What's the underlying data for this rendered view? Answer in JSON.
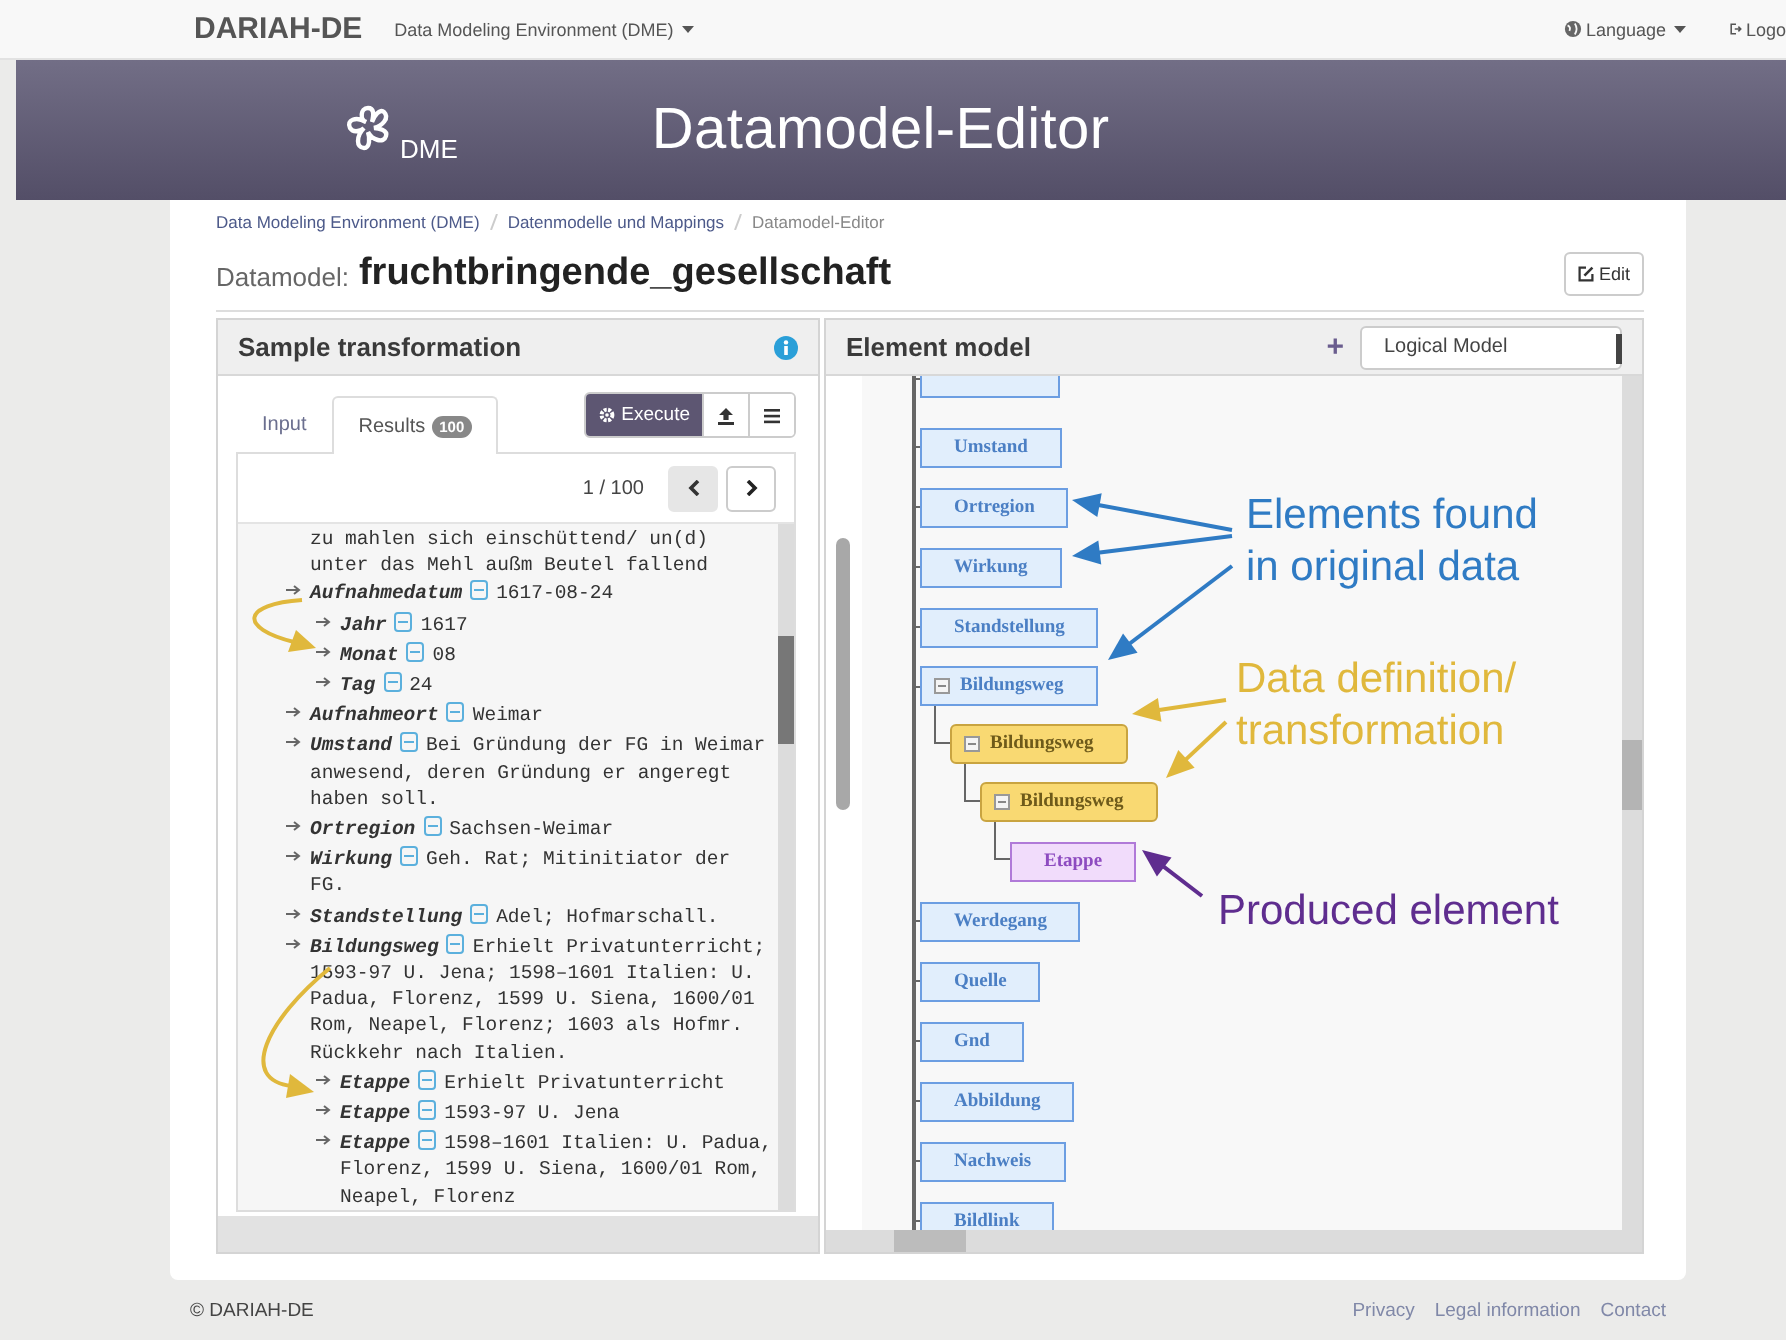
{
  "navbar": {
    "brand": "DARIAH-DE",
    "app_menu": "Data Modeling Environment (DME)",
    "language_menu": "Language",
    "logout": "Logo"
  },
  "banner": {
    "logo_text": "DME",
    "title": "Datamodel-Editor"
  },
  "breadcrumb": [
    {
      "label": "Data Modeling Environment (DME)",
      "current": false
    },
    {
      "label": "Datenmodelle und Mappings",
      "current": false
    },
    {
      "label": "Datamodel-Editor",
      "current": true
    }
  ],
  "heading": {
    "prefix": "Datamodel:",
    "name": "fruchtbringende_gesellschaft",
    "edit_button": "Edit"
  },
  "sample_panel": {
    "title": "Sample transformation",
    "tabs": [
      {
        "label": "Input",
        "selected": false
      },
      {
        "label": "Results",
        "badge": "100",
        "selected": true
      }
    ],
    "execute_button": "Execute",
    "pager": {
      "label": "1 / 100",
      "prev_disabled": true
    },
    "result": {
      "tail": [
        "zu mahlen sich einschüttend/ un(d)",
        "unter das Mehl außm Beutel fallend"
      ],
      "entries": [
        {
          "name": "Aufnahmedatum",
          "value": "1617-08-24",
          "children": [
            {
              "name": "Jahr",
              "value": "1617"
            },
            {
              "name": "Monat",
              "value": "08"
            },
            {
              "name": "Tag",
              "value": "24"
            }
          ]
        },
        {
          "name": "Aufnahmeort",
          "value": "Weimar"
        },
        {
          "name": "Umstand",
          "value": [
            "Bei Gründung der FG in Weimar",
            "anwesend, deren Gründung er angeregt",
            "haben soll."
          ]
        },
        {
          "name": "Ortregion",
          "value": "Sachsen-Weimar"
        },
        {
          "name": "Wirkung",
          "value": [
            "Geh. Rat; Mitinitiator der",
            "FG."
          ]
        },
        {
          "name": "Standstellung",
          "value": "Adel; Hofmarschall."
        },
        {
          "name": "Bildungsweg",
          "value": [
            "Erhielt Privatunterricht;",
            "1593-97 U. Jena; 1598–1601 Italien: U.",
            "Padua, Florenz, 1599 U. Siena, 1600/01",
            "Rom, Neapel, Florenz; 1603 als Hofmr.",
            "Rückkehr nach Italien."
          ],
          "children": [
            {
              "name": "Etappe",
              "value": "Erhielt Privatunterricht"
            },
            {
              "name": "Etappe",
              "value": "1593-97 U. Jena"
            },
            {
              "name": "Etappe",
              "value": [
                "1598–1601 Italien: U. Padua,",
                "Florenz, 1599 U. Siena, 1600/01 Rom,",
                "Neapel, Florenz"
              ]
            }
          ]
        }
      ]
    }
  },
  "element_panel": {
    "title": "Element model",
    "add_button": "+",
    "model_select": "Logical Model",
    "nodes": [
      {
        "label": "Umstand",
        "kind": "source"
      },
      {
        "label": "Ortregion",
        "kind": "source"
      },
      {
        "label": "Wirkung",
        "kind": "source"
      },
      {
        "label": "Standstellung",
        "kind": "source"
      },
      {
        "label": "Bildungsweg",
        "kind": "source",
        "children": [
          {
            "label": "Bildungsweg",
            "kind": "definition",
            "children": [
              {
                "label": "Bildungsweg",
                "kind": "definition",
                "children": [
                  {
                    "label": "Etappe",
                    "kind": "produced"
                  }
                ]
              }
            ]
          }
        ]
      },
      {
        "label": "Werdegang",
        "kind": "source"
      },
      {
        "label": "Quelle",
        "kind": "source"
      },
      {
        "label": "Gnd",
        "kind": "source"
      },
      {
        "label": "Abbildung",
        "kind": "source"
      },
      {
        "label": "Nachweis",
        "kind": "source"
      },
      {
        "label": "Bildlink",
        "kind": "source"
      }
    ],
    "annotations": [
      {
        "kind": "source",
        "color": "#2f7bc4",
        "lines": [
          "Elements found",
          "in original data"
        ]
      },
      {
        "kind": "definition",
        "color": "#e0b83c",
        "lines": [
          "Data definition/",
          "transformation"
        ]
      },
      {
        "kind": "produced",
        "color": "#5f2d8f",
        "lines": [
          "Produced element"
        ]
      }
    ]
  },
  "footer": {
    "copyright": "© DARIAH-DE",
    "links": [
      "Privacy",
      "Legal information",
      "Contact"
    ]
  }
}
